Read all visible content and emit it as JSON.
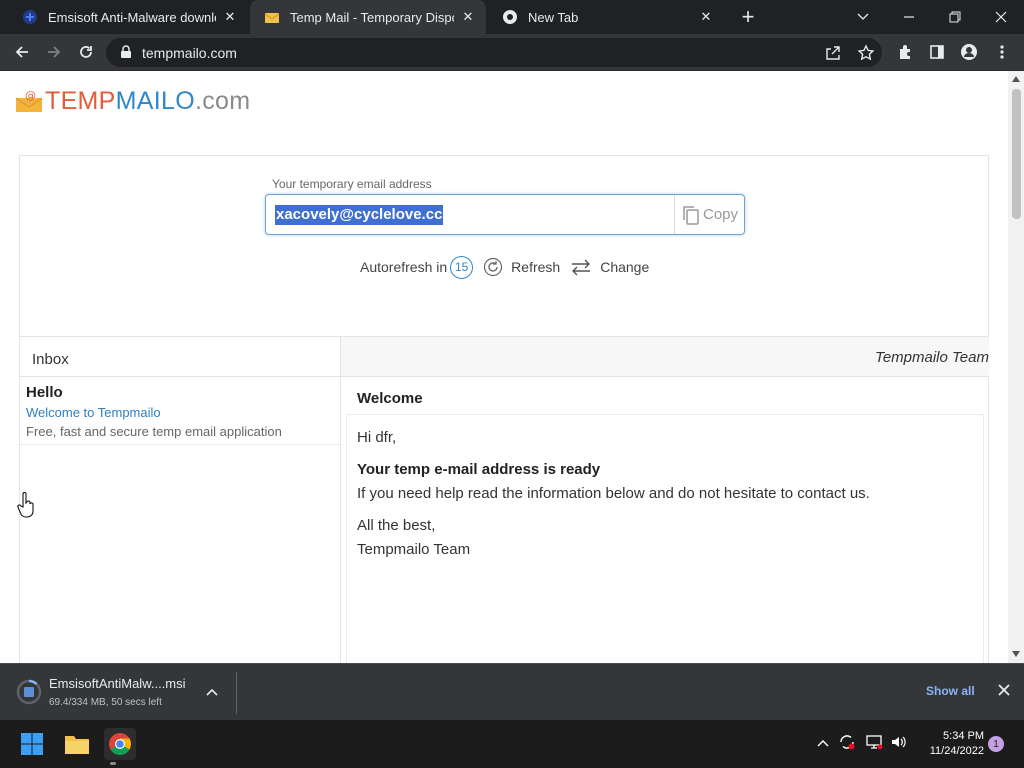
{
  "browser": {
    "tabs": [
      {
        "title": "Emsisoft Anti-Malware download",
        "active": false,
        "icon": "emsisoft-icon"
      },
      {
        "title": "Temp Mail - Temporary Disposable",
        "active": true,
        "icon": "tempmailo-icon"
      },
      {
        "title": "New Tab",
        "active": false,
        "icon": "chrome-icon"
      }
    ],
    "url": "tempmailo.com"
  },
  "site": {
    "logo": {
      "part1": "TEMP",
      "part2": "MAILO",
      "part3": ".com"
    },
    "address_label": "Your temporary email address",
    "address_value": "xacovely@cyclelove.cc",
    "address_visible": "xacovely@cyclelove.cc",
    "copy_label": "Copy",
    "autorefresh_label": "Autorefresh in",
    "autorefresh_count": "15",
    "refresh_label": "Refresh",
    "change_label": "Change"
  },
  "inbox": {
    "title": "Inbox",
    "sender_header": "Tempmailo Team",
    "messages": [
      {
        "from": "Hello",
        "subject": "Welcome to Tempmailo",
        "preview": "Free, fast and secure temp email application"
      }
    ]
  },
  "reader": {
    "subject": "Welcome",
    "greeting": "Hi dfr,",
    "headline": "Your temp e-mail address is ready",
    "line1": "If you need help read the information below and do not hesitate to contact us.",
    "signoff": "All the best,",
    "signature": "Tempmailo Team"
  },
  "download": {
    "filename": "EmsisoftAntiMalw....msi",
    "status": "69.4/334 MB, 50 secs left",
    "show_all": "Show all"
  },
  "taskbar": {
    "time": "5:34 PM",
    "date": "11/24/2022",
    "notification_count": "1"
  },
  "colors": {
    "accent": "#2f88c9",
    "logo_orange": "#e25d3c",
    "selection": "#3f6fd1",
    "chrome_dark": "#35363a"
  }
}
